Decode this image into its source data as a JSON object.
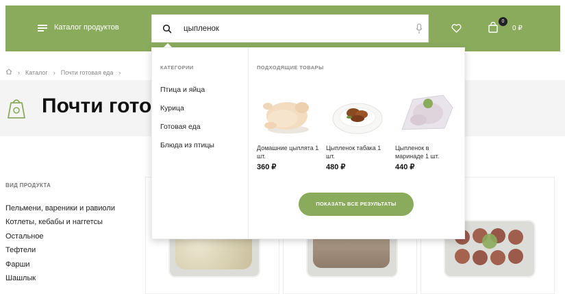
{
  "header": {
    "catalog_label": "Каталог продуктов",
    "search_value": "цыпленок",
    "cart_count": "0",
    "cart_total": "0 ₽"
  },
  "breadcrumb": {
    "items": [
      "Каталог",
      "Почти готовая еда"
    ]
  },
  "page": {
    "title": "Почти готовая еда"
  },
  "filters": {
    "heading": "ВИД ПРОДУКТА",
    "items": [
      "Пельмени, вареники и равиоли",
      "Котлеты, кебабы и наггетсы",
      "Остальное",
      "Тефтели",
      "Фарши",
      "Шашлык"
    ]
  },
  "dropdown": {
    "categories_heading": "КАТЕГОРИИ",
    "categories": [
      "Птица и яйца",
      "Курица",
      "Готовая еда",
      "Блюда из птицы"
    ],
    "products_heading": "ПОДХОДЯЩИЕ ТОВАРЫ",
    "products": [
      {
        "name": "Домашние цыплята 1 шт.",
        "price": "360 ₽"
      },
      {
        "name": "Цыпленок табака 1 шт.",
        "price": "480 ₽"
      },
      {
        "name": "Цыпленок в маринаде 1 шт.",
        "price": "440 ₽"
      }
    ],
    "show_all_label": "ПОКАЗАТЬ ВСЕ РЕЗУЛЬТАТЫ"
  },
  "colors": {
    "brand_green": "#8aab5c",
    "page_band": "#f4f4f4"
  }
}
